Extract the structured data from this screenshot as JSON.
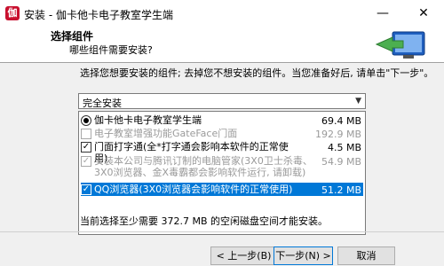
{
  "window": {
    "title": "安装 - 伽卡他卡电子教室学生端",
    "minimize_glyph": "—",
    "close_glyph": "✕",
    "app_icon_glyph": "伽"
  },
  "header": {
    "title": "选择组件",
    "subtitle": "哪些组件需要安装?",
    "logo_icon": "computer-arrow-icon"
  },
  "instructions": "选择您想要安装的组件; 去掉您不想安装的组件。当您准备好后, 请单击\"下一步\"。",
  "install_type": {
    "selected": "完全安装"
  },
  "components": [
    {
      "label": "伽卡他卡电子教室学生端",
      "size": "69.4 MB",
      "control": "radio",
      "checked": true,
      "disabled": false,
      "selected": false
    },
    {
      "label": "电子教室增强功能GateFace门面",
      "size": "192.9 MB",
      "control": "checkbox",
      "checked": false,
      "disabled": true,
      "selected": false
    },
    {
      "label": "门面打字通(全*打字通会影响本软件的正常使用)",
      "size": "4.5 MB",
      "control": "checkbox",
      "checked": true,
      "disabled": false,
      "selected": false
    },
    {
      "label": "安装本公司与腾讯订制的电脑管家(3X0卫士杀毒、3X0浏览器、金X毒霸都会影响软件运行, 请卸载)",
      "size": "54.9 MB",
      "control": "checkbox",
      "checked": true,
      "disabled": true,
      "selected": false
    },
    {
      "label": "QQ浏览器(3X0浏览器会影响软件的正常使用)",
      "size": "51.2 MB",
      "control": "checkbox",
      "checked": true,
      "disabled": false,
      "selected": true
    }
  ],
  "space_required": "当前选择至少需要 372.7 MB 的空闲磁盘空间才能安装。",
  "buttons": {
    "back": "< 上一步(B)",
    "next": "下一步(N) >",
    "cancel": "取消"
  },
  "check_glyph": "✓"
}
